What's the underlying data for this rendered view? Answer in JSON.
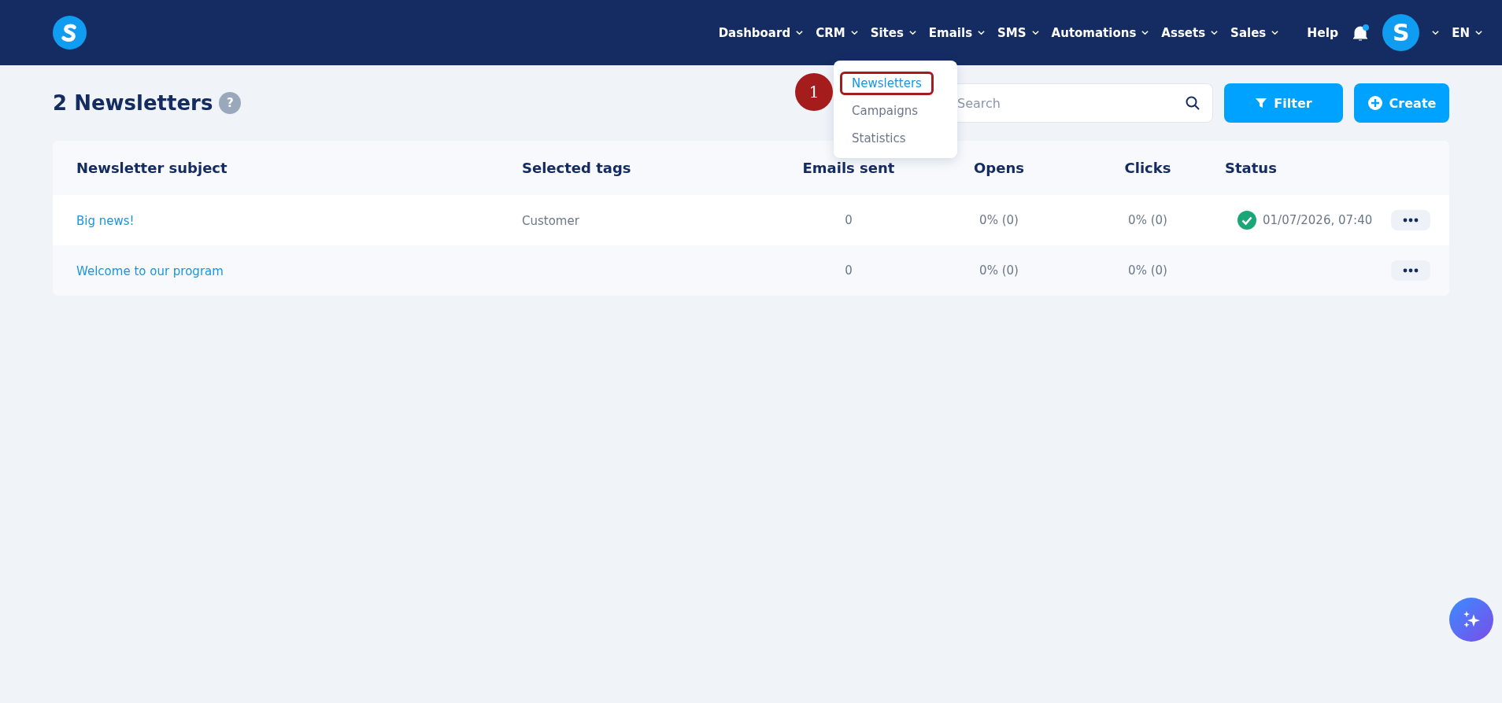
{
  "nav": {
    "items": [
      {
        "label": "Dashboard"
      },
      {
        "label": "CRM"
      },
      {
        "label": "Sites"
      },
      {
        "label": "Emails"
      },
      {
        "label": "SMS"
      },
      {
        "label": "Automations"
      },
      {
        "label": "Assets"
      },
      {
        "label": "Sales"
      }
    ],
    "help": "Help",
    "notification_unread": true,
    "avatar_letter": "S",
    "language": "EN"
  },
  "emails_menu": {
    "items": [
      {
        "label": "Newsletters",
        "selected": true,
        "highlighted": true
      },
      {
        "label": "Campaigns",
        "selected": false,
        "highlighted": false
      },
      {
        "label": "Statistics",
        "selected": false,
        "highlighted": false
      }
    ],
    "annotation": "1"
  },
  "page": {
    "title": "2 Newsletters",
    "help_mark": "?",
    "search": {
      "placeholder": "Search"
    },
    "buttons": [
      {
        "kind": "filter",
        "label": "Filter"
      },
      {
        "kind": "create",
        "label": "Create"
      }
    ]
  },
  "table": {
    "columns": [
      "Newsletter subject",
      "Selected tags",
      "Emails sent",
      "Opens",
      "Clicks",
      "Status"
    ],
    "rows": [
      {
        "subject": "Big news!",
        "tags": "Customer",
        "emails_sent": "0",
        "opens": "0% (0)",
        "clicks": "0% (0)",
        "status": "01/07/2026, 07:40",
        "sent": true
      },
      {
        "subject": "Welcome to our program",
        "tags": "",
        "emails_sent": "0",
        "opens": "0% (0)",
        "clicks": "0% (0)",
        "status": "",
        "sent": false
      }
    ]
  }
}
